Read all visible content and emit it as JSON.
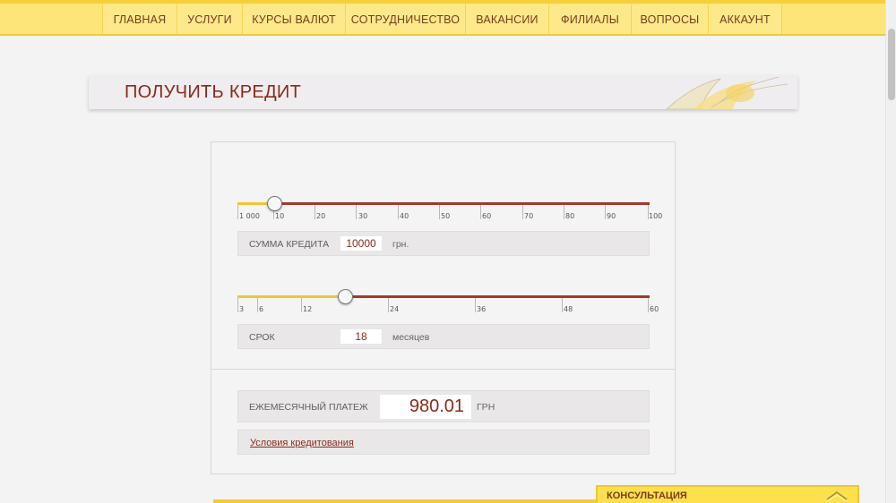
{
  "nav": {
    "items": [
      "ГЛАВНАЯ",
      "УСЛУГИ",
      "КУРСЫ ВАЛЮТ",
      "СОТРУДНИЧЕСТВО",
      "ВАКАНСИИ",
      "ФИЛИАЛЫ",
      "ВОПРОСЫ",
      "АККАУНТ"
    ]
  },
  "page": {
    "title": "ПОЛУЧИТЬ КРЕДИТ"
  },
  "calculator": {
    "amount_slider": {
      "tick_labels": [
        "1 000",
        "10",
        "20",
        "30",
        "40",
        "50",
        "60",
        "70",
        "80",
        "90",
        "100"
      ],
      "value": 10000,
      "value_fraction": 0.09
    },
    "amount_field": {
      "label": "СУММА КРЕДИТА",
      "value": "10000",
      "unit": "грн."
    },
    "term_slider": {
      "tick_labels": [
        "3",
        "6",
        "12",
        "24",
        "36",
        "48",
        "60"
      ],
      "value": 18,
      "value_fraction": 0.26
    },
    "term_field": {
      "label": "СРОК",
      "value": "18",
      "unit": "месяцев"
    },
    "payment": {
      "label": "ЕЖЕМЕСЯЧНЫЙ ПЛАТЕЖ",
      "value": "980.01",
      "unit": "ГРН"
    },
    "terms_link": "Условия кредитования"
  },
  "consult": {
    "label": "КОНСУЛЬТАЦИЯ"
  },
  "colors": {
    "nav_bg": "#fde677",
    "accent_yellow": "#f1c634",
    "accent_red": "#a3392a",
    "title_red": "#8a2a1a"
  }
}
